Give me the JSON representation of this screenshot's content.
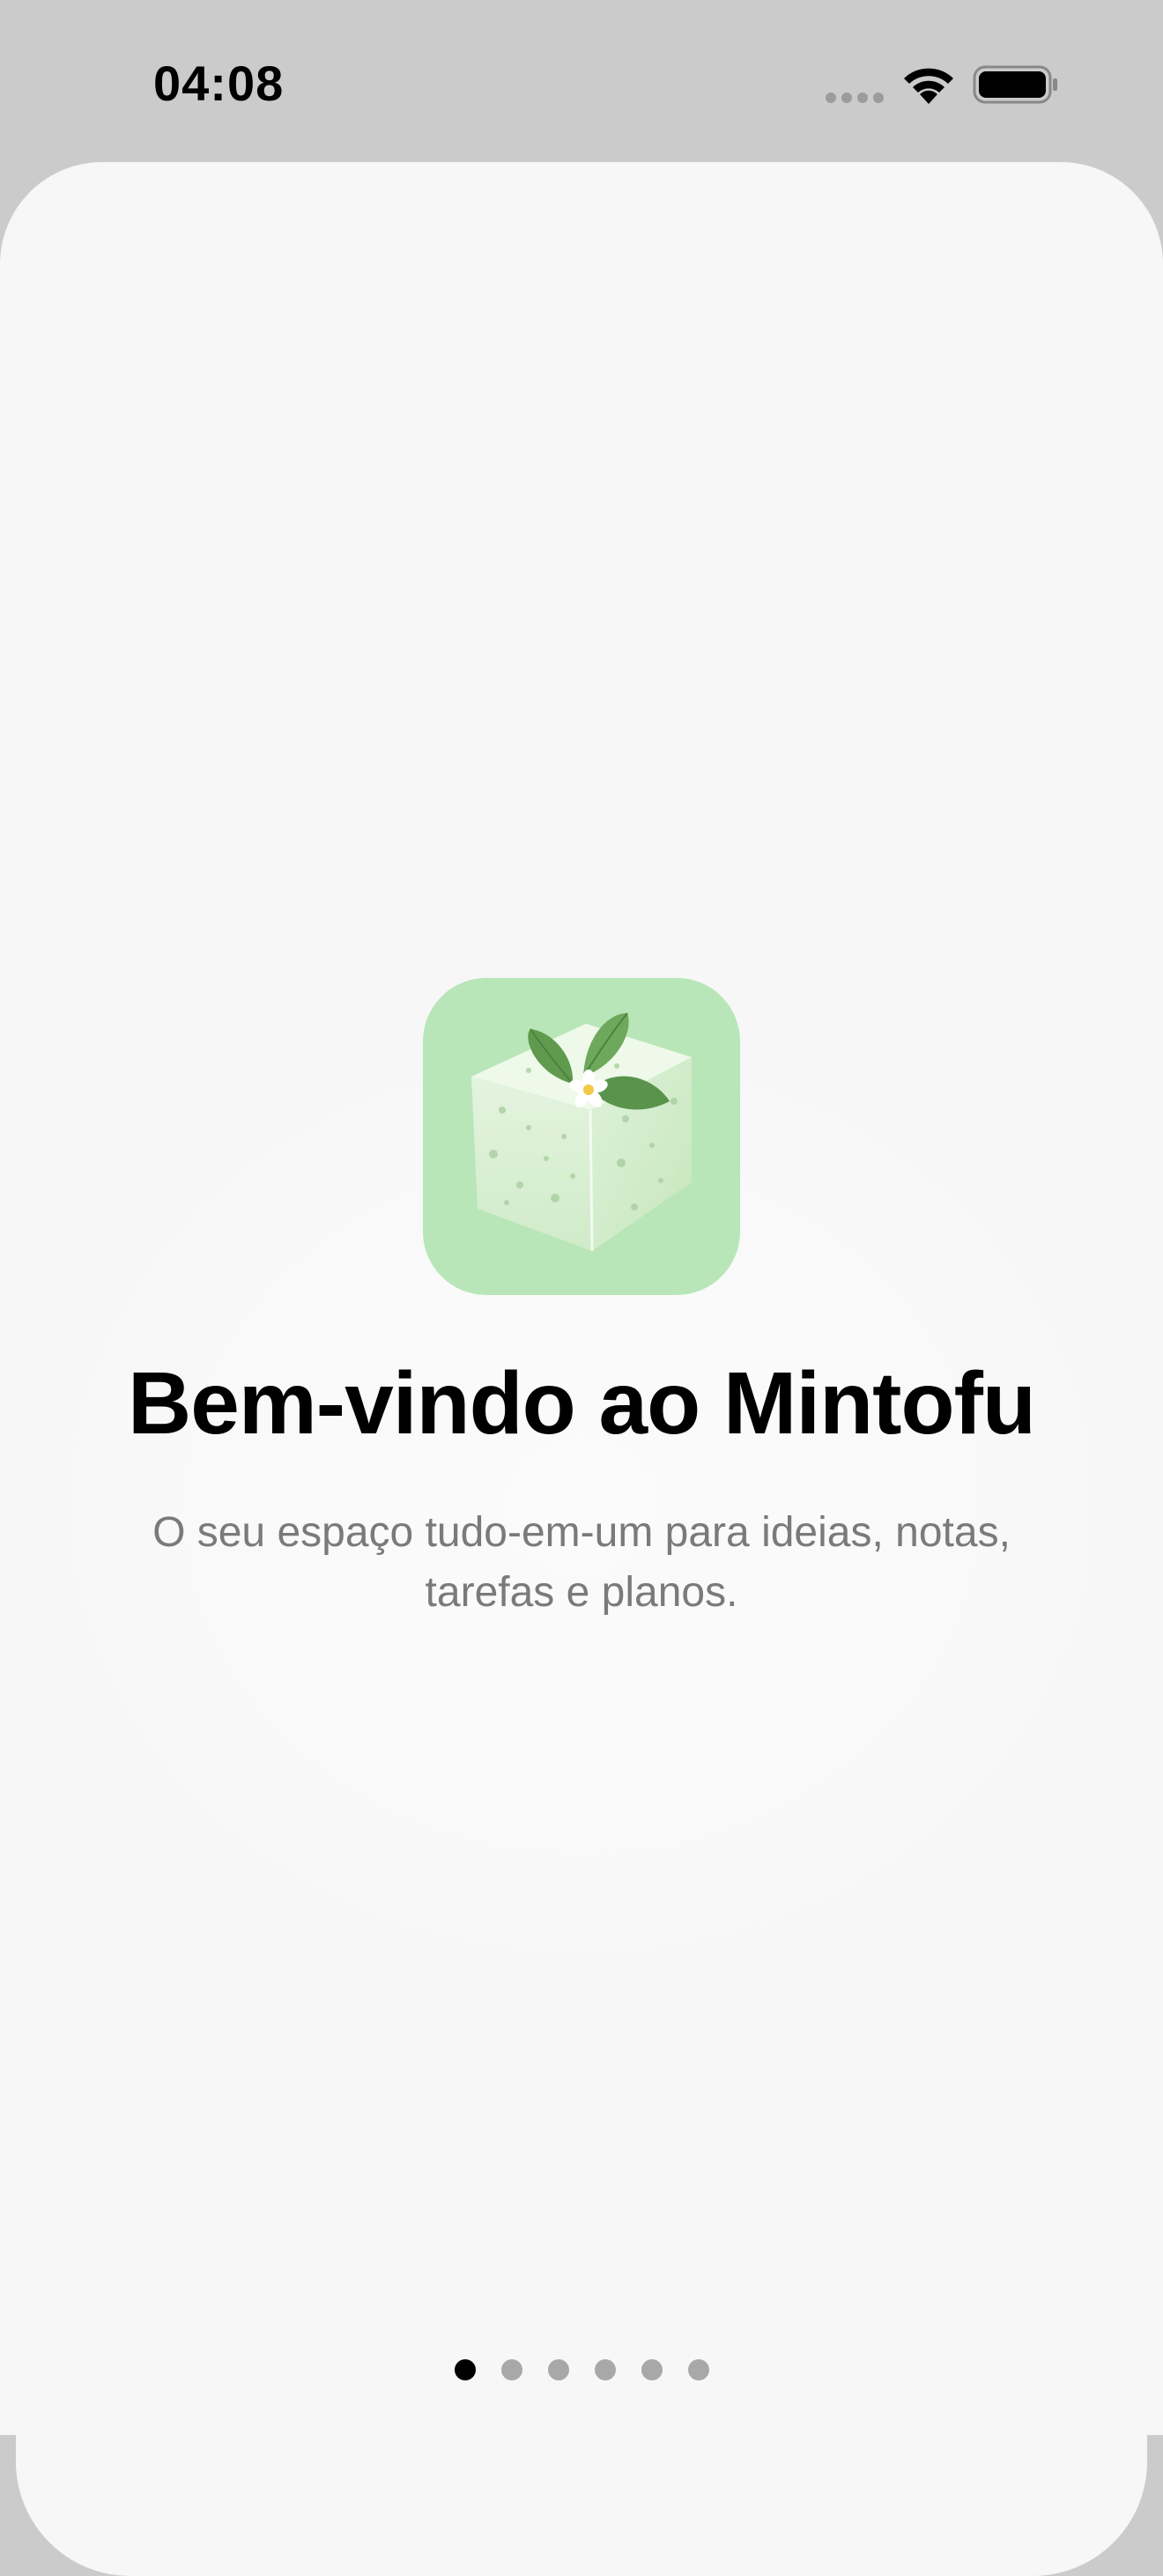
{
  "status_bar": {
    "time": "04:08",
    "icons": [
      "signal-dots-icon",
      "wifi-icon",
      "battery-icon"
    ]
  },
  "onboarding": {
    "app_icon": "mintofu-tofu-icon",
    "title": "Bem-vindo ao Mintofu",
    "subtitle": "O seu espaço tudo-em-um para ideias, notas, tarefas e planos.",
    "page_indicator": {
      "total": 6,
      "current": 1
    }
  },
  "colors": {
    "background": "#cbcbcb",
    "sheet": "#f7f7f7",
    "icon_bg": "#b8e6b8",
    "leaf": "#5f9a4f",
    "dot_active": "#000000",
    "dot_inactive": "#a8a8a8",
    "subtitle": "#7a7a7a"
  }
}
